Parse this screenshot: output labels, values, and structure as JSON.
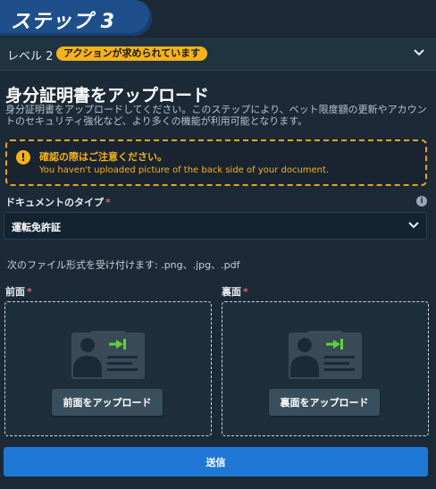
{
  "header": {
    "step_title": "ステップ 3"
  },
  "level": {
    "label": "レベル 2",
    "badge": "アクションが求められています",
    "badge_color": "#f5b21a"
  },
  "main": {
    "title": "身分証明書をアップロード",
    "description": "身分証明書をアップロードしてください。このステップにより、ベット限度額の更新やアカウントのセキュリティ強化など、より多くの機能が利用可能となります。"
  },
  "warning": {
    "icon": "exclamation-icon",
    "title": "確認の際はご注意ください。",
    "message": "You haven't uploaded picture of the back side of your document."
  },
  "document_type": {
    "label": "ドキュメントのタイプ",
    "required_mark": "*",
    "selected": "運転免許証"
  },
  "formats_text": "次のファイル形式を受け付けます: .png、.jpg、.pdf",
  "front": {
    "label": "前面",
    "required_mark": "*",
    "button": "前面をアップロード"
  },
  "back": {
    "label": "裏面",
    "required_mark": "*",
    "button": "裏面をアップロード"
  },
  "submit_label": "送信",
  "colors": {
    "accent": "#1f78d6",
    "warning": "#f5b21a",
    "background": "#1b2a36"
  }
}
